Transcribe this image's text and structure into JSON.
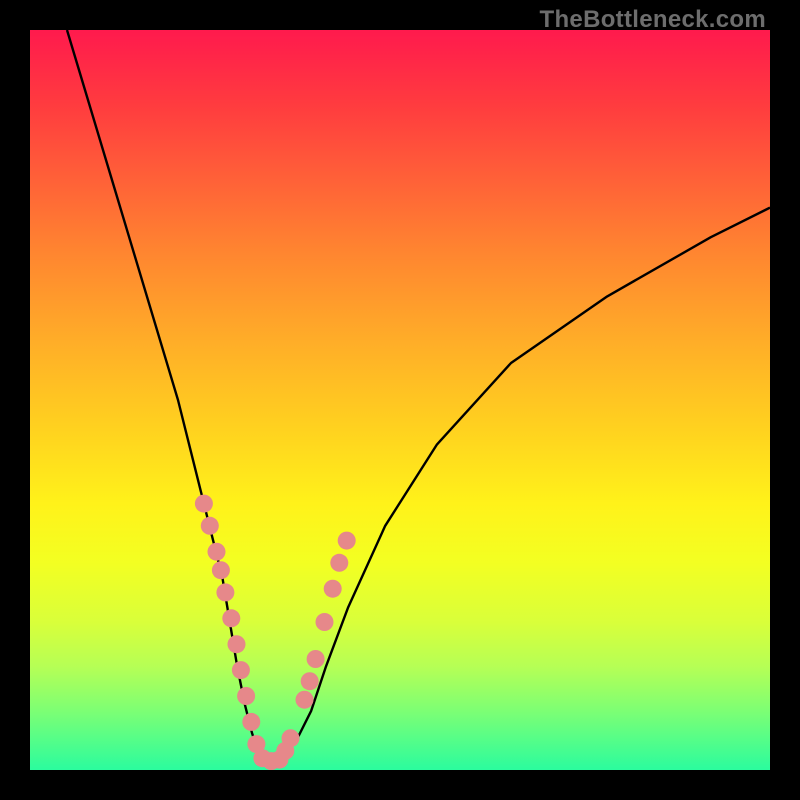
{
  "watermark": "TheBottleneck.com",
  "chart_data": {
    "type": "line",
    "title": "",
    "xlabel": "",
    "ylabel": "",
    "xlim": [
      0,
      100
    ],
    "ylim": [
      0,
      100
    ],
    "series": [
      {
        "name": "bottleneck-curve",
        "x": [
          5,
          8,
          11,
          14,
          17,
          20,
          22,
          24,
          26,
          27,
          28,
          29,
          30,
          31,
          32,
          33,
          34,
          36,
          38,
          40,
          43,
          48,
          55,
          65,
          78,
          92,
          100
        ],
        "values": [
          100,
          90,
          80,
          70,
          60,
          50,
          42,
          34,
          26,
          20,
          14,
          9,
          5,
          2,
          1,
          1,
          2,
          4,
          8,
          14,
          22,
          33,
          44,
          55,
          64,
          72,
          76
        ]
      }
    ],
    "markers": {
      "name": "highlighted-points",
      "color": "#e6888a",
      "x": [
        23.5,
        24.3,
        25.2,
        25.8,
        26.4,
        27.2,
        27.9,
        28.5,
        29.2,
        29.9,
        30.6,
        31.4,
        32.6,
        33.7,
        34.5,
        35.2,
        37.1,
        37.8,
        38.6,
        39.8,
        40.9,
        41.8,
        42.8
      ],
      "values": [
        36,
        33,
        29.5,
        27,
        24,
        20.5,
        17,
        13.5,
        10,
        6.5,
        3.5,
        1.6,
        1.2,
        1.4,
        2.6,
        4.3,
        9.5,
        12,
        15,
        20,
        24.5,
        28,
        31
      ]
    }
  }
}
